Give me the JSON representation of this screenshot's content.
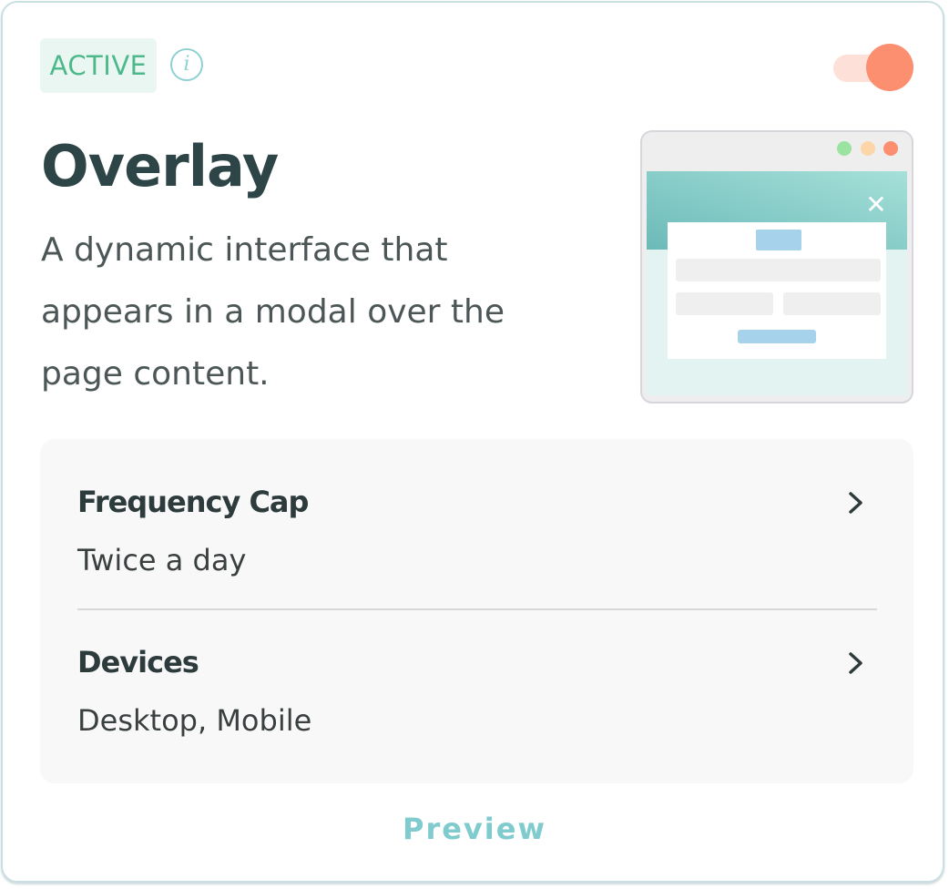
{
  "status": {
    "badge": "ACTIVE",
    "info_symbol": "i",
    "toggle_on": true
  },
  "card": {
    "title": "Overlay",
    "description": "A dynamic interface that appears in a modal over the page content."
  },
  "illustration": {
    "close_symbol": "✕",
    "window_dots": [
      "#9be3a0",
      "#fcd6a8",
      "#fc8f70"
    ]
  },
  "settings": [
    {
      "label": "Frequency Cap",
      "value": "Twice a day"
    },
    {
      "label": "Devices",
      "value": "Desktop, Mobile"
    }
  ],
  "footer": {
    "preview_label": "Preview"
  },
  "colors": {
    "accent": "#7fcbcd",
    "active_green": "#4db88a",
    "toggle": "#fc8f70"
  }
}
